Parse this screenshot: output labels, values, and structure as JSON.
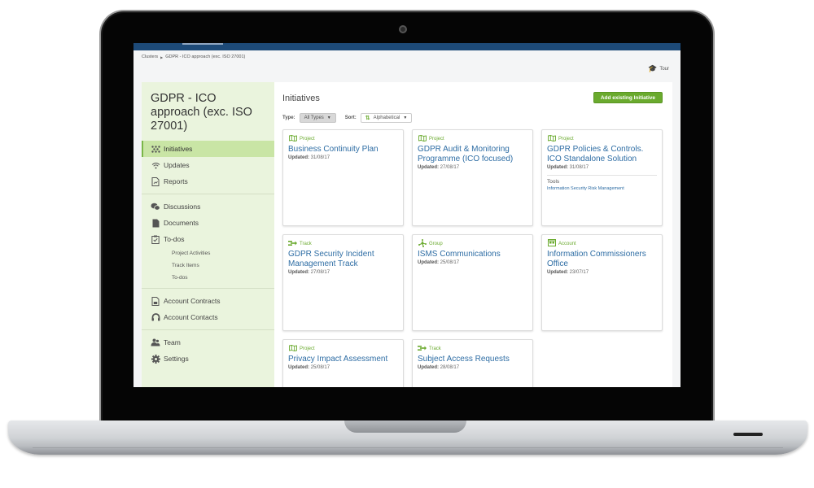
{
  "breadcrumb": {
    "items": [
      "Clusters",
      "GDPR - ICO approach (exc. ISO 27001)"
    ],
    "separator": "▶"
  },
  "tour": {
    "label": "Tour",
    "icon": "graduation-cap-icon"
  },
  "sidebar": {
    "title": "GDPR - ICO approach (exc. ISO 27001)",
    "groups": [
      [
        {
          "label": "Initiatives",
          "icon": "initiatives-icon",
          "active": true
        },
        {
          "label": "Updates",
          "icon": "wifi-icon"
        },
        {
          "label": "Reports",
          "icon": "report-icon"
        }
      ],
      [
        {
          "label": "Discussions",
          "icon": "chat-bubbles-icon"
        },
        {
          "label": "Documents",
          "icon": "document-icon"
        },
        {
          "label": "To-dos",
          "icon": "clipboard-check-icon"
        }
      ],
      [
        {
          "label": "Account Contracts",
          "icon": "contract-icon"
        },
        {
          "label": "Account Contacts",
          "icon": "headset-icon"
        }
      ],
      [
        {
          "label": "Team",
          "icon": "team-icon"
        },
        {
          "label": "Settings",
          "icon": "gear-icon"
        }
      ]
    ],
    "todo_subitems": [
      "Project Activities",
      "Track Items",
      "To-dos"
    ]
  },
  "main": {
    "title": "Initiatives",
    "add_button": "Add existing Initiative",
    "filters": {
      "type_label": "Type:",
      "type_value": "All Types",
      "sort_label": "Sort:",
      "sort_value": "Alphabetical"
    },
    "colors": {
      "accent": "#6aaa2e",
      "link": "#2e6da4",
      "topbar": "#1d4a78",
      "sidebar_bg": "#eaf4dd"
    },
    "cards": [
      {
        "type": "Project",
        "icon": "map-icon",
        "title": "Business Continuity Plan",
        "updated_label": "Updated:",
        "updated": "31/08/17"
      },
      {
        "type": "Project",
        "icon": "map-icon",
        "title": "GDPR Audit & Monitoring Programme (ICO focused)",
        "updated_label": "Updated:",
        "updated": "27/08/17"
      },
      {
        "type": "Project",
        "icon": "map-icon",
        "title": "GDPR Policies & Controls. ICO Standalone Solution",
        "updated_label": "Updated:",
        "updated": "31/08/17",
        "tools_label": "Tools",
        "tools": [
          "Information Security Risk Management"
        ]
      },
      {
        "type": "Track",
        "icon": "track-icon",
        "title": "GDPR Security Incident Management Track",
        "updated_label": "Updated:",
        "updated": "27/08/17"
      },
      {
        "type": "Group",
        "icon": "group-icon",
        "title": "ISMS Communications",
        "updated_label": "Updated:",
        "updated": "25/08/17"
      },
      {
        "type": "Account",
        "icon": "account-icon",
        "title": "Information Commissioners Office",
        "updated_label": "Updated:",
        "updated": "23/07/17"
      },
      {
        "type": "Project",
        "icon": "map-icon",
        "title": "Privacy Impact Assessment",
        "updated_label": "Updated:",
        "updated": "25/08/17"
      },
      {
        "type": "Track",
        "icon": "track-icon",
        "title": "Subject Access Requests",
        "updated_label": "Updated:",
        "updated": "28/08/17"
      }
    ]
  }
}
